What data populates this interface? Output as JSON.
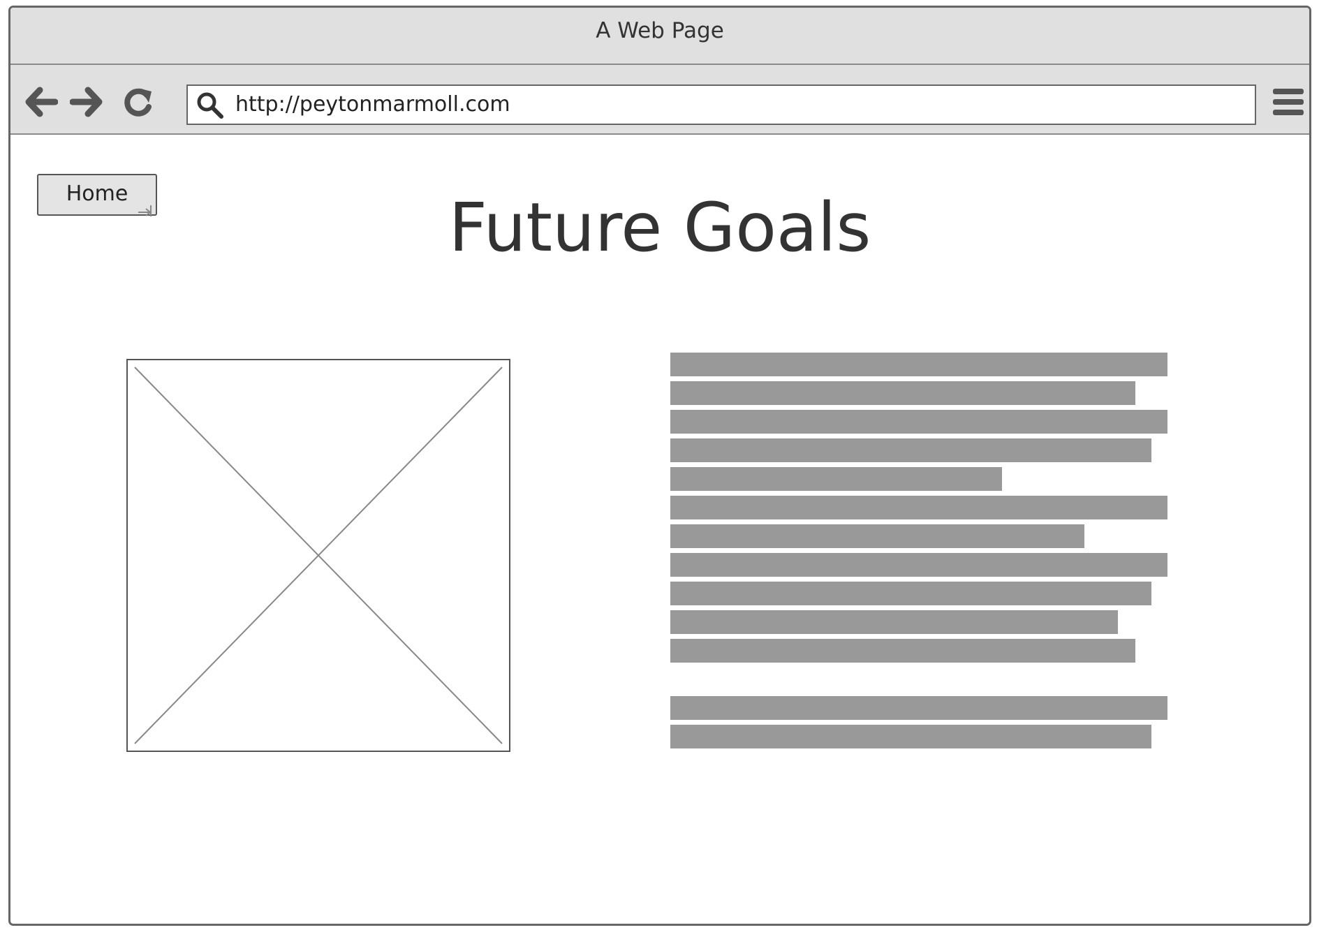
{
  "window": {
    "title": "A Web Page"
  },
  "toolbar": {
    "back_icon": "arrow-left-icon",
    "forward_icon": "arrow-right-icon",
    "reload_icon": "reload-icon",
    "menu_icon": "hamburger-menu-icon",
    "address_bar": {
      "url": "http://peytonmarmoll.com",
      "icon": "search-icon"
    }
  },
  "page": {
    "home_button_label": "Home",
    "title": "Future Goals",
    "image_placeholder_icon": "image-placeholder-icon",
    "text_block": {
      "line_fill_fractions": [
        1.0,
        0.935,
        1.0,
        0.967,
        0.667,
        1.0,
        0.833,
        1.0,
        0.967,
        0.9,
        0.935,
        1.0,
        0.967
      ],
      "paragraph_break_after_line": 11
    }
  },
  "colors": {
    "chrome_background": "#e0e0e0",
    "border": "#666666",
    "text_line_fill": "#999999",
    "text": "#333333"
  }
}
